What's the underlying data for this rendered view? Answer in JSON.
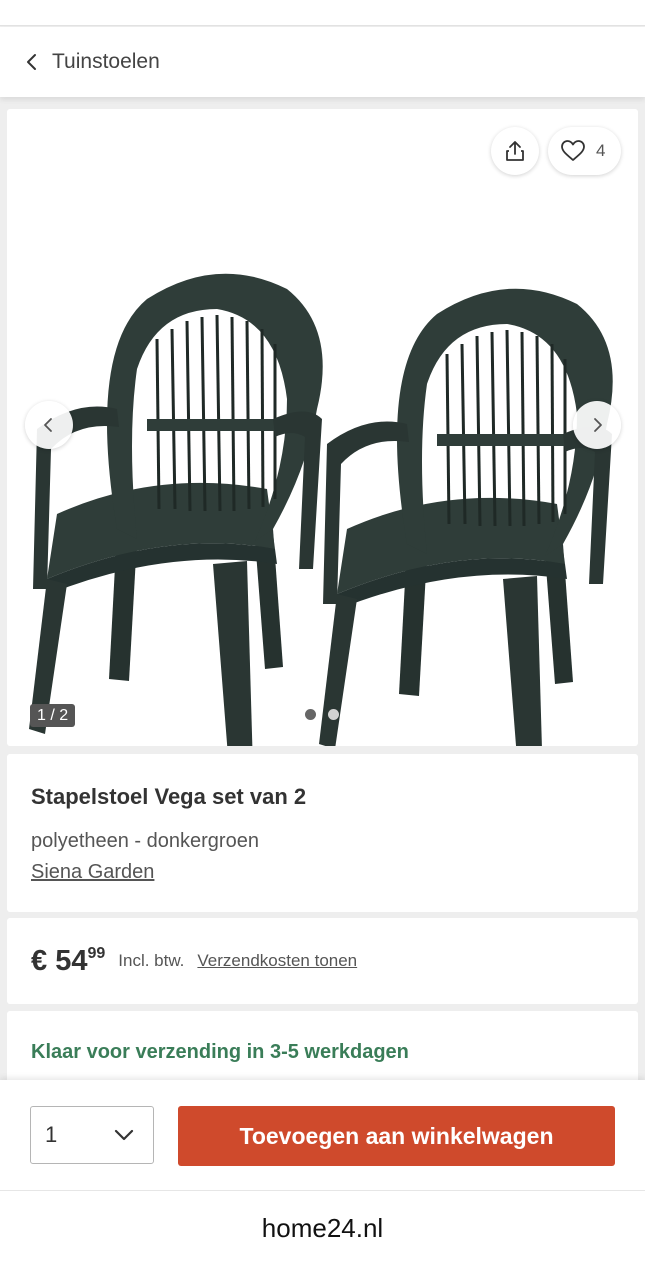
{
  "header": {
    "back_label": "Tuinstoelen"
  },
  "gallery": {
    "favorites_count": "4",
    "counter": "1 / 2",
    "image_count": 2,
    "active_image": 1,
    "product_color": "#2f3d39"
  },
  "product": {
    "title": "Stapelstoel Vega set van 2",
    "subtitle": "polyetheen - donkergroen",
    "brand": "Siena Garden"
  },
  "price": {
    "currency": "€",
    "whole": "54",
    "cents": "99",
    "vat_note": "Incl. btw.",
    "shipping_link": "Verzendkosten tonen"
  },
  "delivery": {
    "text": "Klaar voor verzending in 3-5 werkdagen",
    "color": "#3a7d58"
  },
  "cart": {
    "quantity": "1",
    "add_label": "Toevoegen aan winkelwagen",
    "button_color": "#cf4a2c"
  },
  "browser": {
    "url": "home24.nl"
  }
}
